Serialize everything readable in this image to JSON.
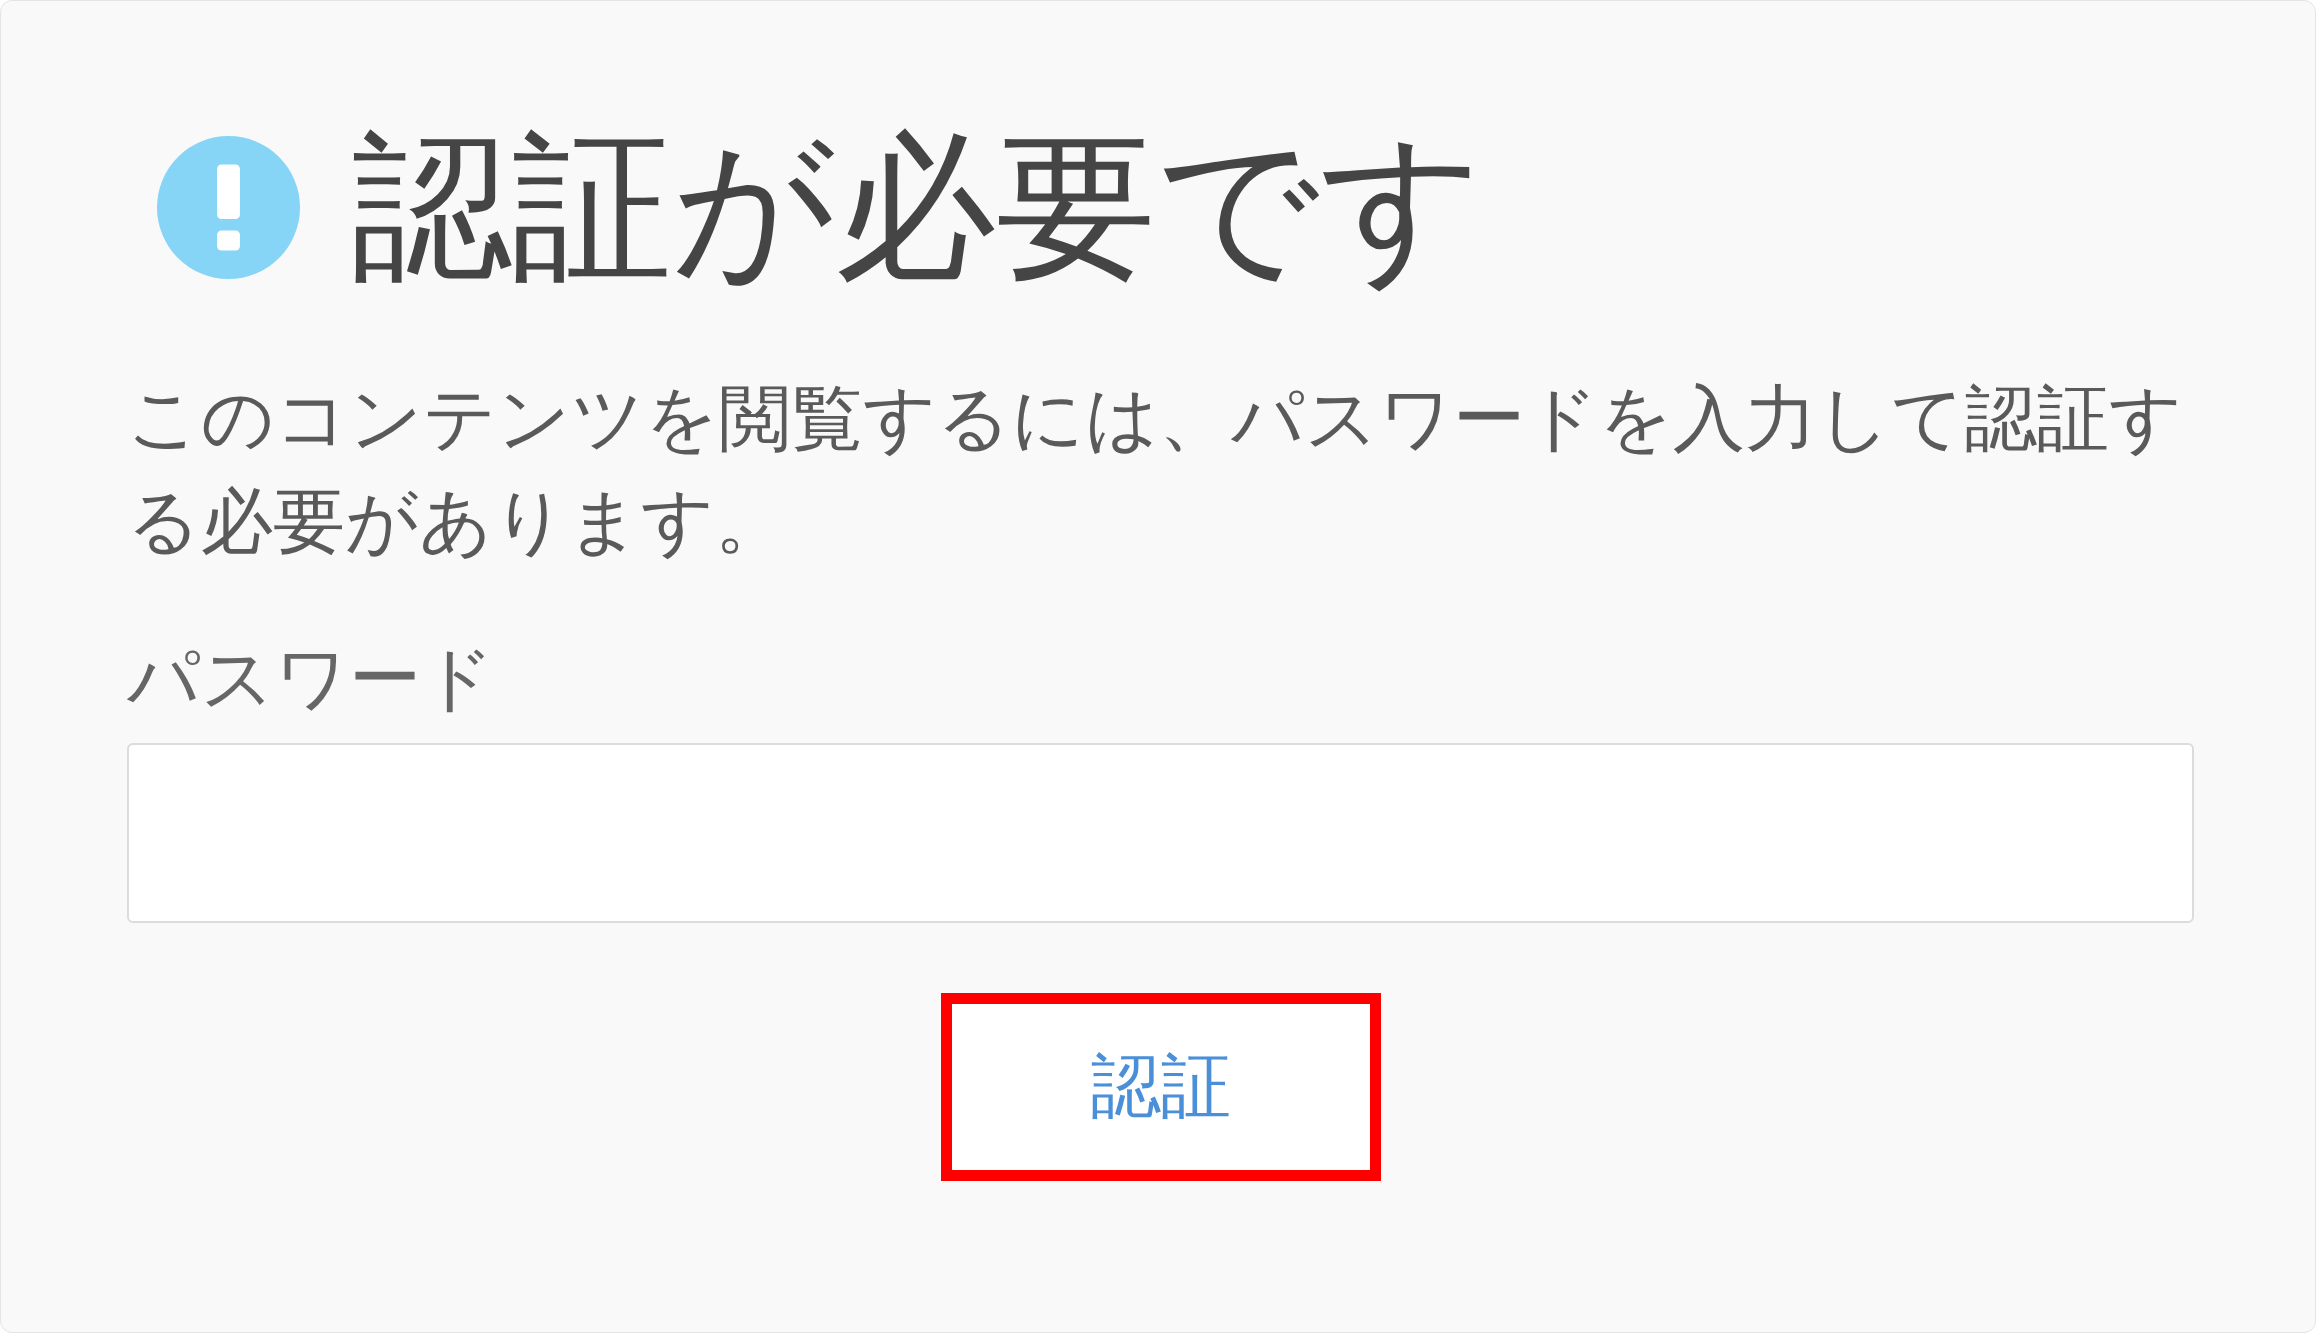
{
  "title": "認証が必要です",
  "message": "このコンテンツを閲覧するには、パスワードを入力して認証する必要があります。",
  "password": {
    "label": "パスワード"
  },
  "submit": {
    "label": "認証",
    "highlighted": true
  }
}
